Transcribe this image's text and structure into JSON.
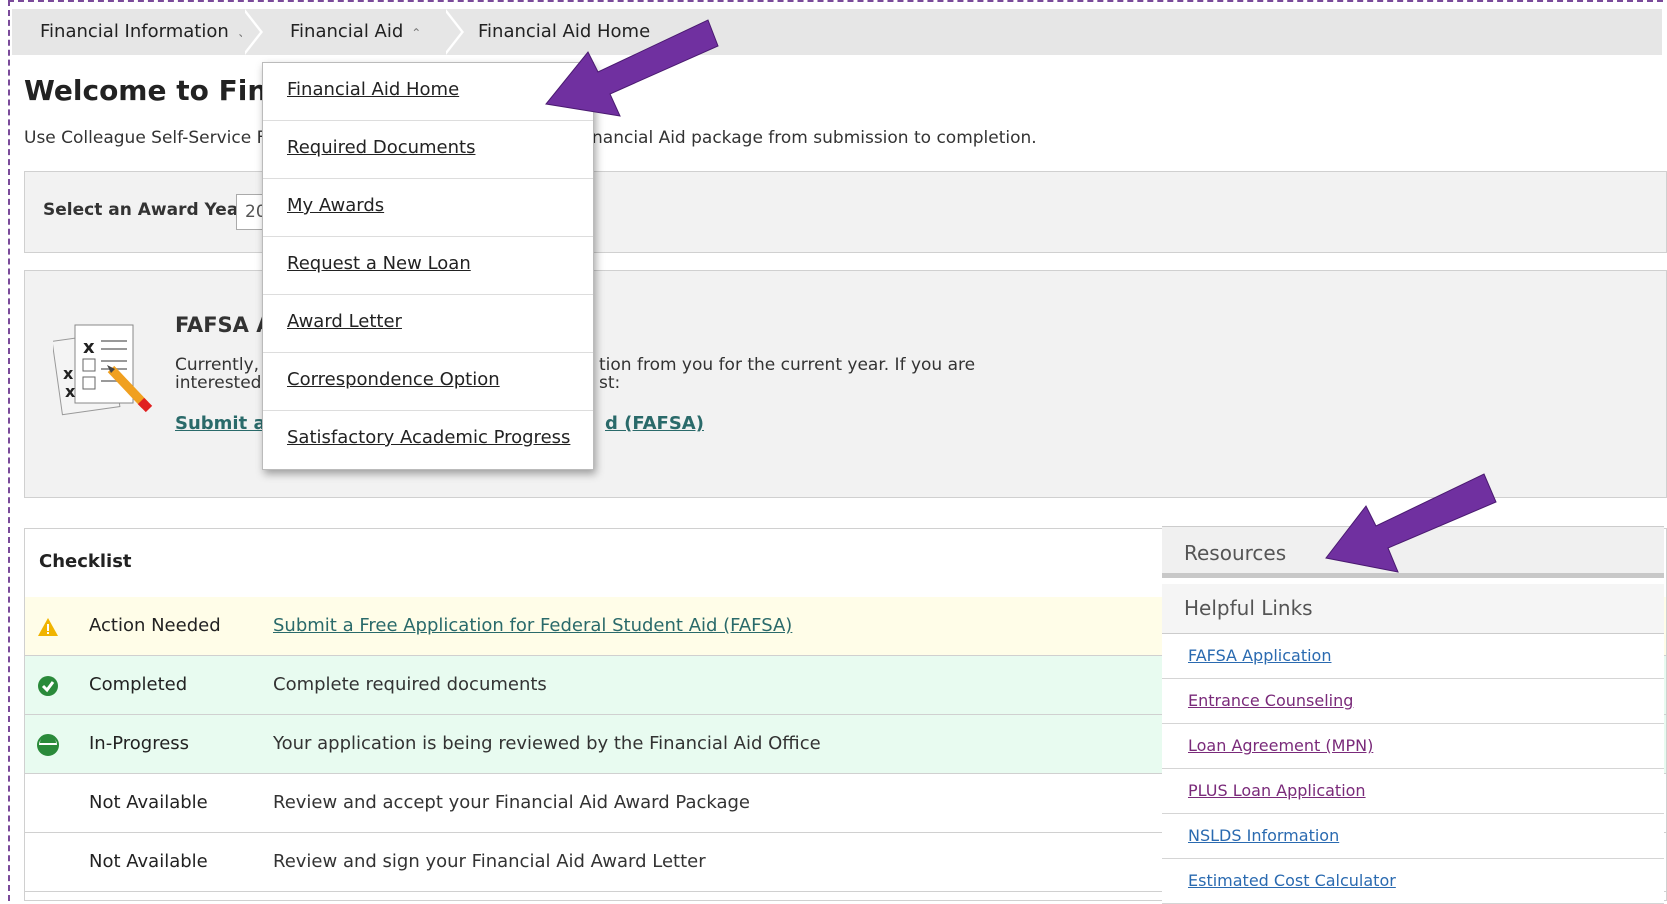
{
  "breadcrumb": {
    "items": [
      {
        "label": "Financial Information"
      },
      {
        "label": "Financial Aid"
      },
      {
        "label": "Financial Aid Home"
      }
    ]
  },
  "page": {
    "title": "Welcome to Finan",
    "intro_left": "Use Colleague Self-Service Fi",
    "intro_right": "nancial Aid package from submission to completion."
  },
  "award_year": {
    "label": "Select an Award Year:",
    "value": "20"
  },
  "fafsa_card": {
    "title": "FAFSA A",
    "text_line1_left": "Currently,",
    "text_line2_left": "interested",
    "text_line1_right": "tion from you for the current year. If you are",
    "text_line2_right": "st:",
    "link_left": "Submit a F",
    "link_right": "d (FAFSA)"
  },
  "dropdown_menu": {
    "items": [
      {
        "label": "Financial Aid Home"
      },
      {
        "label": "Required Documents"
      },
      {
        "label": "My Awards"
      },
      {
        "label": "Request a New Loan"
      },
      {
        "label": "Award Letter"
      },
      {
        "label": "Correspondence Option"
      },
      {
        "label": "Satisfactory Academic Progress"
      }
    ]
  },
  "checklist": {
    "title": "Checklist",
    "rows": [
      {
        "status": "Action Needed",
        "description": "Submit a Free Application for Federal Student Aid (FAFSA)",
        "icon": "warning-icon"
      },
      {
        "status": "Completed",
        "description": "Complete required documents",
        "icon": "check-circle-icon"
      },
      {
        "status": "In-Progress",
        "description": "Your application is being reviewed by the Financial Aid Office",
        "icon": "half-circle-icon"
      },
      {
        "status": "Not Available",
        "description": "Review and accept your Financial Aid Award Package",
        "icon": ""
      },
      {
        "status": "Not Available",
        "description": "Review and sign your Financial Aid Award Letter",
        "icon": ""
      }
    ]
  },
  "resources": {
    "title": "Resources",
    "subtitle": "Helpful Links",
    "links": [
      {
        "label": "FAFSA Application",
        "color": "#2a6ab0"
      },
      {
        "label": "Entrance Counseling",
        "color": "#7a2a7a"
      },
      {
        "label": "Loan Agreement (MPN)",
        "color": "#7a2a7a"
      },
      {
        "label": "PLUS Loan Application",
        "color": "#7a2a7a"
      },
      {
        "label": "NSLDS Information",
        "color": "#2a6ab0"
      },
      {
        "label": "Estimated Cost Calculator",
        "color": "#2a6ab0"
      }
    ]
  },
  "colors": {
    "annotation_arrow": "#7030a0",
    "warning": "#f0b400",
    "success": "#2a8a3a"
  }
}
